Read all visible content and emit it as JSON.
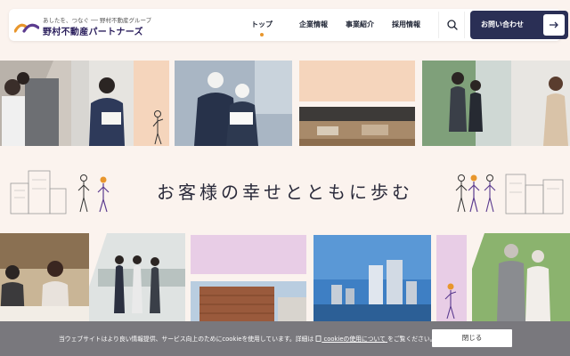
{
  "brand": {
    "tagline": "あしたを、つなぐ ── 野村不動産グループ",
    "name": "野村不動産パートナーズ",
    "colors": {
      "orange": "#e8962c",
      "purple": "#5b3b8f",
      "navy": "#2a2f55"
    }
  },
  "nav": {
    "items": [
      {
        "label": "トップ",
        "active": true
      },
      {
        "label": "企業情報",
        "active": false
      },
      {
        "label": "事業紹介",
        "active": false
      },
      {
        "label": "採用情報",
        "active": false
      }
    ],
    "search_icon": "search-icon",
    "contact_label": "お問い合わせ",
    "contact_icon": "arrow-right-icon"
  },
  "hero": {
    "headline": "お客様の幸せとともに歩む"
  },
  "cookie": {
    "text_before": "当ウェブサイトはより良い情報提供、サービス向上のためにcookieを使用しています。詳細は",
    "link_label": "cookieの使用について",
    "text_after": "をご覧ください。",
    "close_label": "閉じる"
  }
}
